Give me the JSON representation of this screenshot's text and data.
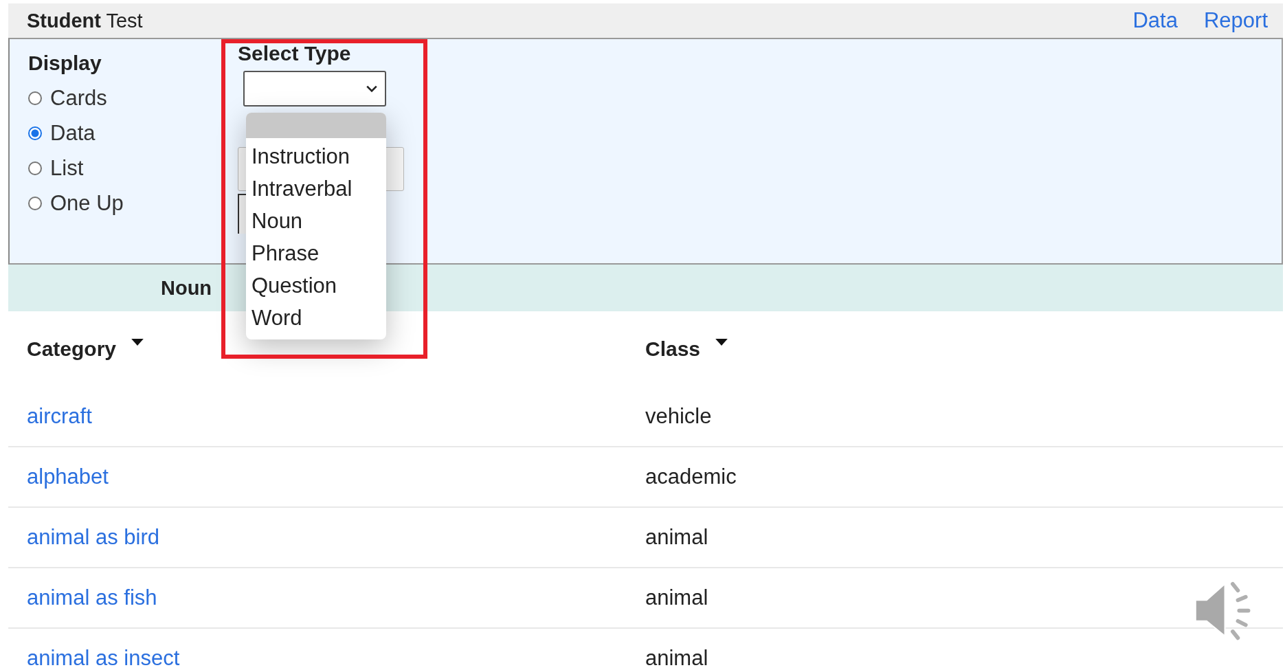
{
  "header": {
    "title_bold": "Student",
    "title_rest": "Test",
    "links": [
      "Data",
      "Report"
    ]
  },
  "display": {
    "label": "Display",
    "options": [
      {
        "label": "Cards",
        "selected": false
      },
      {
        "label": "Data",
        "selected": true
      },
      {
        "label": "List",
        "selected": false
      },
      {
        "label": "One Up",
        "selected": false
      }
    ]
  },
  "type_select": {
    "label": "Select Type",
    "expanded": true,
    "blank_highlighted": true,
    "options": [
      {
        "label": "Instruction",
        "selected": false
      },
      {
        "label": "Intraverbal",
        "selected": false
      },
      {
        "label": "Noun",
        "selected": false
      },
      {
        "label": "Phrase",
        "selected": false
      },
      {
        "label": "Question",
        "selected": false
      },
      {
        "label": "Word",
        "selected": false
      }
    ]
  },
  "section_title": "Noun",
  "table": {
    "columns": [
      "Category",
      "Class"
    ],
    "rows": [
      [
        "aircraft",
        "vehicle"
      ],
      [
        "alphabet",
        "academic"
      ],
      [
        "animal as bird",
        "animal"
      ],
      [
        "animal as fish",
        "animal"
      ],
      [
        "animal as insect",
        "animal"
      ]
    ]
  }
}
